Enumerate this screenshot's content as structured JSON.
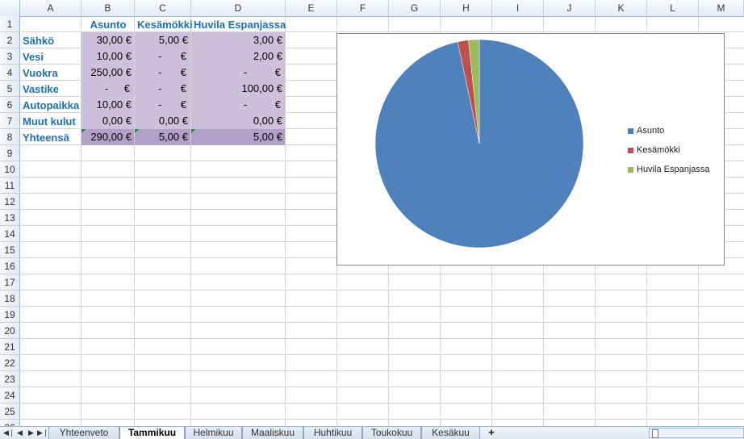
{
  "columns": [
    "A",
    "B",
    "C",
    "D",
    "E",
    "F",
    "G",
    "H",
    "I",
    "J",
    "K",
    "L",
    "M"
  ],
  "rows": [
    "1",
    "2",
    "3",
    "4",
    "5",
    "6",
    "7",
    "8",
    "9",
    "10",
    "11",
    "12",
    "13",
    "14",
    "15",
    "16",
    "17",
    "18",
    "19",
    "20",
    "21",
    "22",
    "23",
    "24",
    "25",
    "26"
  ],
  "headers": {
    "b": "Asunto",
    "c": "Kesämökki",
    "d": "Huvila Espanjassa"
  },
  "table": [
    {
      "label": "Sähkö",
      "b": "30,00 €",
      "c": "5,00 €",
      "d": "3,00 €"
    },
    {
      "label": "Vesi",
      "b": "10,00 €",
      "c": "-",
      "d": "2,00 €"
    },
    {
      "label": "Vuokra",
      "b": "250,00 €",
      "c": "-",
      "d": "-"
    },
    {
      "label": "Vastike",
      "b": "-",
      "c": "-",
      "d": "100,00 €"
    },
    {
      "label": "Autopaikka",
      "b": "10,00 €",
      "c": "-",
      "d": "-"
    },
    {
      "label": "Muut kulut",
      "b": "0,00 €",
      "c": "0,00 €",
      "d": "0,00 €"
    },
    {
      "label": "Yhteensä",
      "b": "290,00 €",
      "c": "5,00 €",
      "d": "5,00 €"
    }
  ],
  "currency_symbol": "€",
  "chart_data": {
    "type": "pie",
    "categories": [
      "Asunto",
      "Kesämökki",
      "Huvila Espanjassa"
    ],
    "values": [
      290,
      5,
      5
    ],
    "colors": [
      "#4f81bd",
      "#c0504d",
      "#9bbb59"
    ],
    "legend_position": "right"
  },
  "tabs": [
    "Yhteenveto",
    "Tammikuu",
    "Helmikuu",
    "Maaliskuu",
    "Huhtikuu",
    "Toukokuu",
    "Kesäkuu"
  ],
  "active_tab": "Tammikuu",
  "nav_icons": [
    "first-sheet-icon",
    "prev-sheet-icon",
    "next-sheet-icon",
    "last-sheet-icon",
    "insert-sheet-icon"
  ]
}
